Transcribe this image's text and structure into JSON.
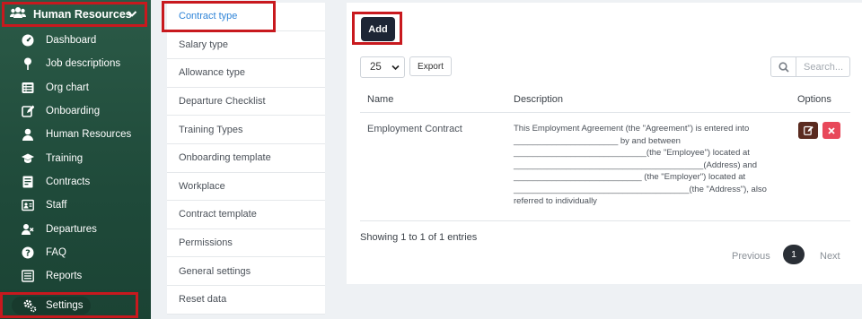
{
  "sidebar": {
    "header": "Human Resources",
    "items": [
      {
        "label": "Dashboard",
        "icon": "dashboard-icon"
      },
      {
        "label": "Job descriptions",
        "icon": "pin-icon"
      },
      {
        "label": "Org chart",
        "icon": "list-icon"
      },
      {
        "label": "Onboarding",
        "icon": "edit-icon"
      },
      {
        "label": "Human Resources",
        "icon": "user-icon"
      },
      {
        "label": "Training",
        "icon": "graduation-cap-icon"
      },
      {
        "label": "Contracts",
        "icon": "contract-icon"
      },
      {
        "label": "Staff",
        "icon": "id-card-icon"
      },
      {
        "label": "Departures",
        "icon": "user-remove-icon"
      },
      {
        "label": "FAQ",
        "icon": "question-icon"
      },
      {
        "label": "Reports",
        "icon": "report-icon"
      }
    ],
    "settings": "Settings"
  },
  "menu": {
    "items": [
      "Contract type",
      "Salary type",
      "Allowance type",
      "Departure Checklist",
      "Training Types",
      "Onboarding template",
      "Workplace",
      "Contract template",
      "Permissions",
      "General settings",
      "Reset data"
    ],
    "active_index": 0
  },
  "toolbar": {
    "add_label": "Add",
    "page_length": "25",
    "export_label": "Export",
    "search_placeholder": "Search..."
  },
  "table": {
    "headers": [
      "Name",
      "Description",
      "Options"
    ],
    "rows": [
      {
        "name": "Employment Contract",
        "description_lines": [
          "This Employment Agreement (the \"Agreement\") is entered into",
          "______________________ by and between",
          "____________________________(the \"Employee\") located at",
          "________________________________________(Address) and",
          "___________________________ (the \"Employer\") located at",
          "_____________________________________(the \"Address\"), also",
          "referred to individually"
        ]
      }
    ]
  },
  "footer": {
    "info": "Showing 1 to 1 of 1 entries",
    "previous": "Previous",
    "page": "1",
    "next": "Next"
  },
  "colors": {
    "sidebar": "#1f4a3a",
    "highlight": "#c8191e",
    "active_link": "#2f84d8",
    "add_button": "#1d2535",
    "edit_button": "#5a2a1f",
    "delete_button": "#e8485a"
  }
}
